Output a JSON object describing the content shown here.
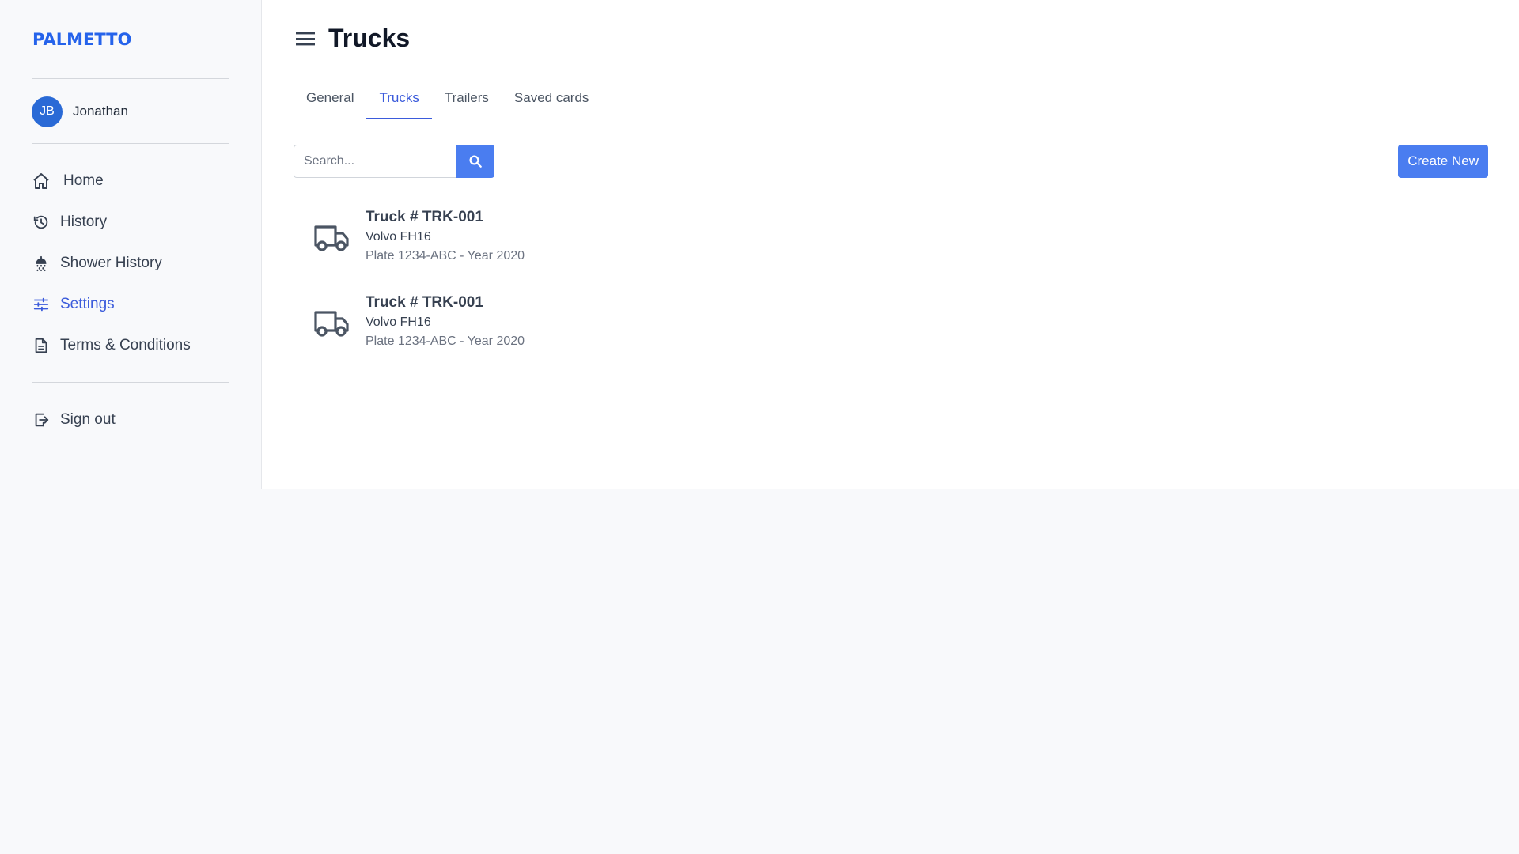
{
  "brand": {
    "logo_text": "PALMETTO",
    "accent": "#3b5bdb",
    "button": "#4a7df0"
  },
  "user": {
    "initials": "JB",
    "name": "Jonathan"
  },
  "sidebar": {
    "items": [
      {
        "label": "Home",
        "icon": "home-icon"
      },
      {
        "label": "History",
        "icon": "history-icon"
      },
      {
        "label": "Shower History",
        "icon": "shower-icon"
      },
      {
        "label": "Settings",
        "icon": "settings-sliders-icon",
        "active": true
      },
      {
        "label": "Terms & Conditions",
        "icon": "document-icon"
      }
    ],
    "signout": {
      "label": "Sign out",
      "icon": "sign-out-icon"
    }
  },
  "header": {
    "title": "Trucks"
  },
  "tabs": [
    {
      "label": "General"
    },
    {
      "label": "Trucks",
      "active": true
    },
    {
      "label": "Trailers"
    },
    {
      "label": "Saved cards"
    }
  ],
  "search": {
    "placeholder": "Search...",
    "value": ""
  },
  "actions": {
    "create_label": "Create New"
  },
  "trucks": [
    {
      "title": "Truck # TRK-001",
      "model": "Volvo FH16",
      "meta": "Plate 1234-ABC - Year 2020",
      "icon": "truck-icon"
    },
    {
      "title": "Truck # TRK-001",
      "model": "Volvo FH16",
      "meta": "Plate 1234-ABC - Year 2020",
      "icon": "truck-icon"
    }
  ]
}
